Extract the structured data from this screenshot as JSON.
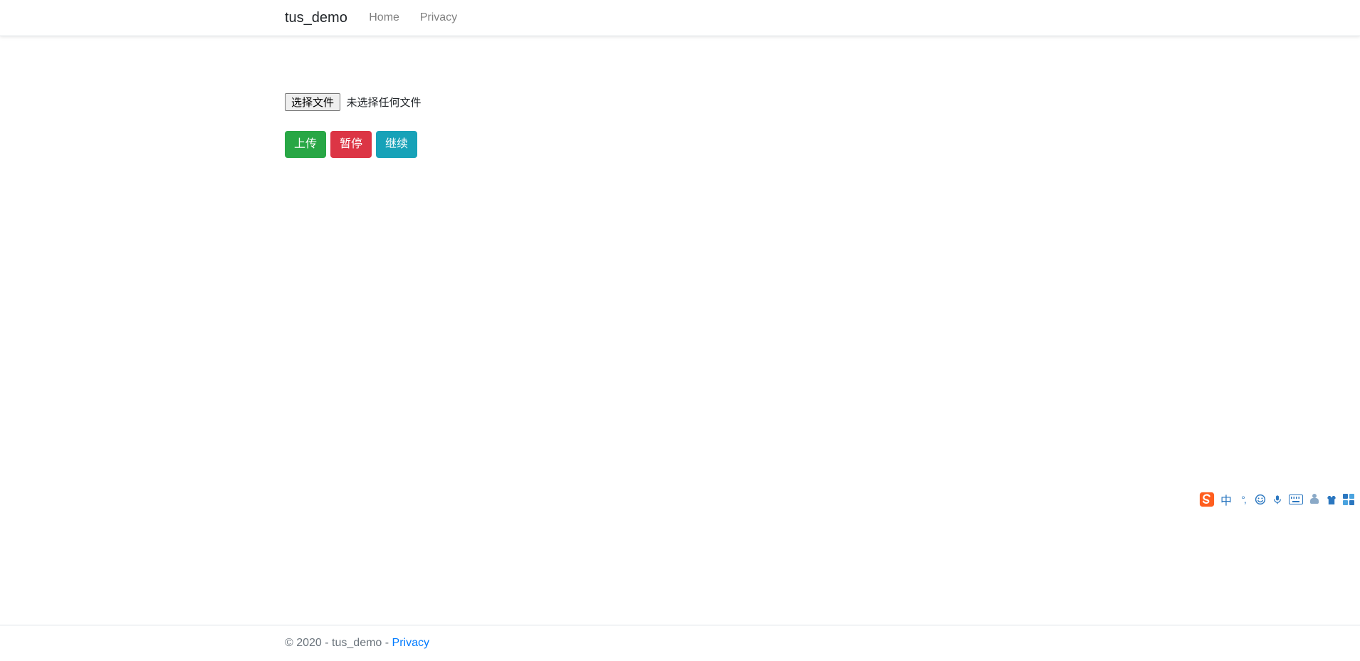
{
  "header": {
    "brand": "tus_demo",
    "nav": [
      {
        "label": "Home"
      },
      {
        "label": "Privacy"
      }
    ]
  },
  "main": {
    "file_input": {
      "button_label": "选择文件",
      "status_text": "未选择任何文件"
    },
    "buttons": {
      "upload": "上传",
      "pause": "暂停",
      "resume": "继续"
    }
  },
  "footer": {
    "copyright": "© 2020 - tus_demo - ",
    "privacy_link": "Privacy"
  },
  "ime": {
    "logo_label": "S",
    "lang": "中",
    "punct": "°,",
    "face": "☺",
    "mic": "🎤"
  }
}
